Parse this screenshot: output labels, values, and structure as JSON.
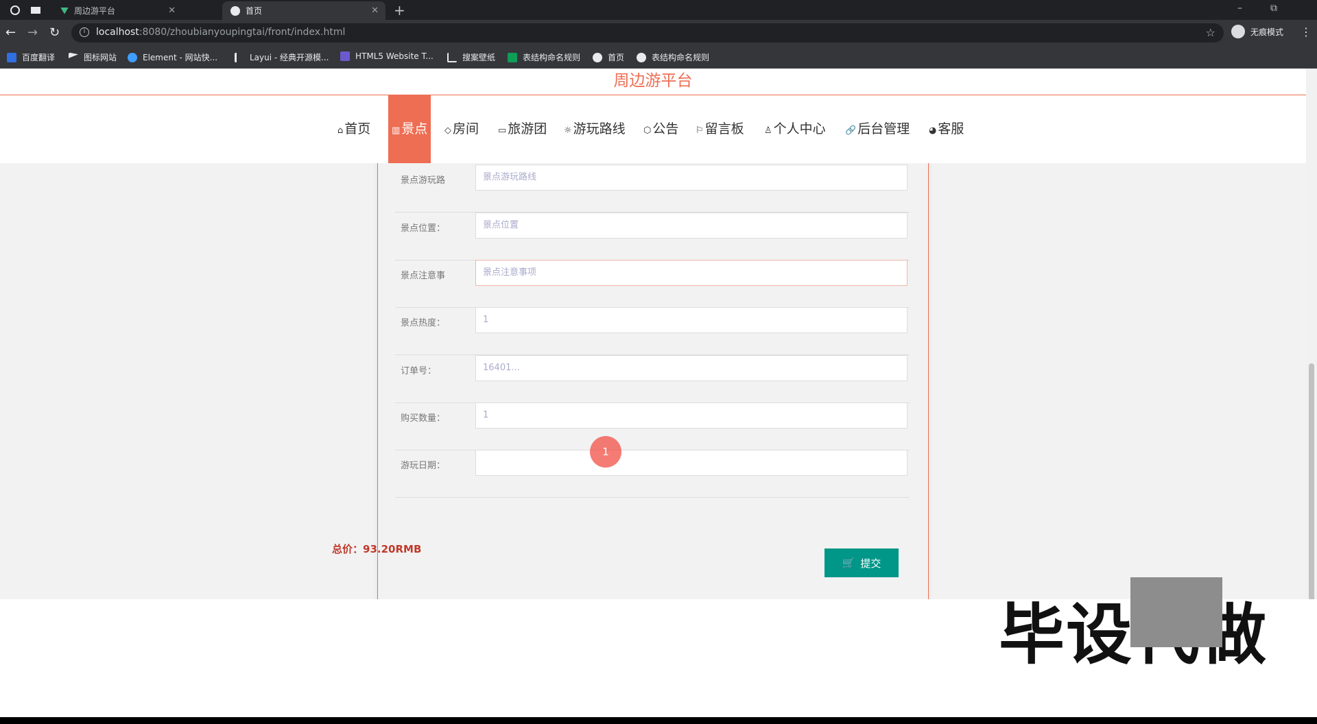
{
  "browser": {
    "tabs": [
      {
        "title": "周边游平台"
      },
      {
        "title": "首页"
      }
    ],
    "url_host": "localhost",
    "url_rest": ":8080/zhoubianyoupingtai/front/index.html",
    "incognito_label": "无痕模式",
    "bookmarks": [
      "百度翻译",
      "图标网站",
      "Element - 网站快...",
      "Layui - 经典开源模...",
      "HTML5 Website T...",
      "搜案壁纸",
      "表结构命名规则",
      "首页",
      "表结构命名规则"
    ]
  },
  "site": {
    "title": "周边游平台",
    "nav": [
      {
        "label": "首页",
        "icon": "home-icon",
        "glyph": "⌂"
      },
      {
        "label": "景点",
        "icon": "scenic-icon",
        "glyph": "▥"
      },
      {
        "label": "房间",
        "icon": "tag-icon",
        "glyph": "◇"
      },
      {
        "label": "旅游团",
        "icon": "flag-icon",
        "glyph": "▭"
      },
      {
        "label": "游玩路线",
        "icon": "route-icon",
        "glyph": "☼"
      },
      {
        "label": "公告",
        "icon": "cube-icon",
        "glyph": "⬡"
      },
      {
        "label": "留言板",
        "icon": "flag-outline-icon",
        "glyph": "⚐"
      },
      {
        "label": "个人中心",
        "icon": "user-icon",
        "glyph": "♙"
      },
      {
        "label": "后台管理",
        "icon": "link-icon",
        "glyph": "🔗"
      },
      {
        "label": "客服",
        "icon": "chat-icon",
        "glyph": "◕"
      }
    ],
    "active_nav": "景点"
  },
  "form": {
    "rows": [
      {
        "label": "景点游玩路",
        "value": "景点游玩路线"
      },
      {
        "label": "景点位置：",
        "value": "景点位置"
      },
      {
        "label": "景点注意事",
        "value": "景点注意事项"
      },
      {
        "label": "景点热度：",
        "value": "1"
      },
      {
        "label": "订单号：",
        "value": "16401..."
      },
      {
        "label": "购买数量：",
        "value": "1"
      },
      {
        "label": "游玩日期：",
        "value": ""
      }
    ],
    "total_label": "总价：",
    "total_value": "93.20RMB",
    "submit_label": "提交"
  },
  "overlay": {
    "cursor_label": "1",
    "watermark": "毕设代做"
  }
}
